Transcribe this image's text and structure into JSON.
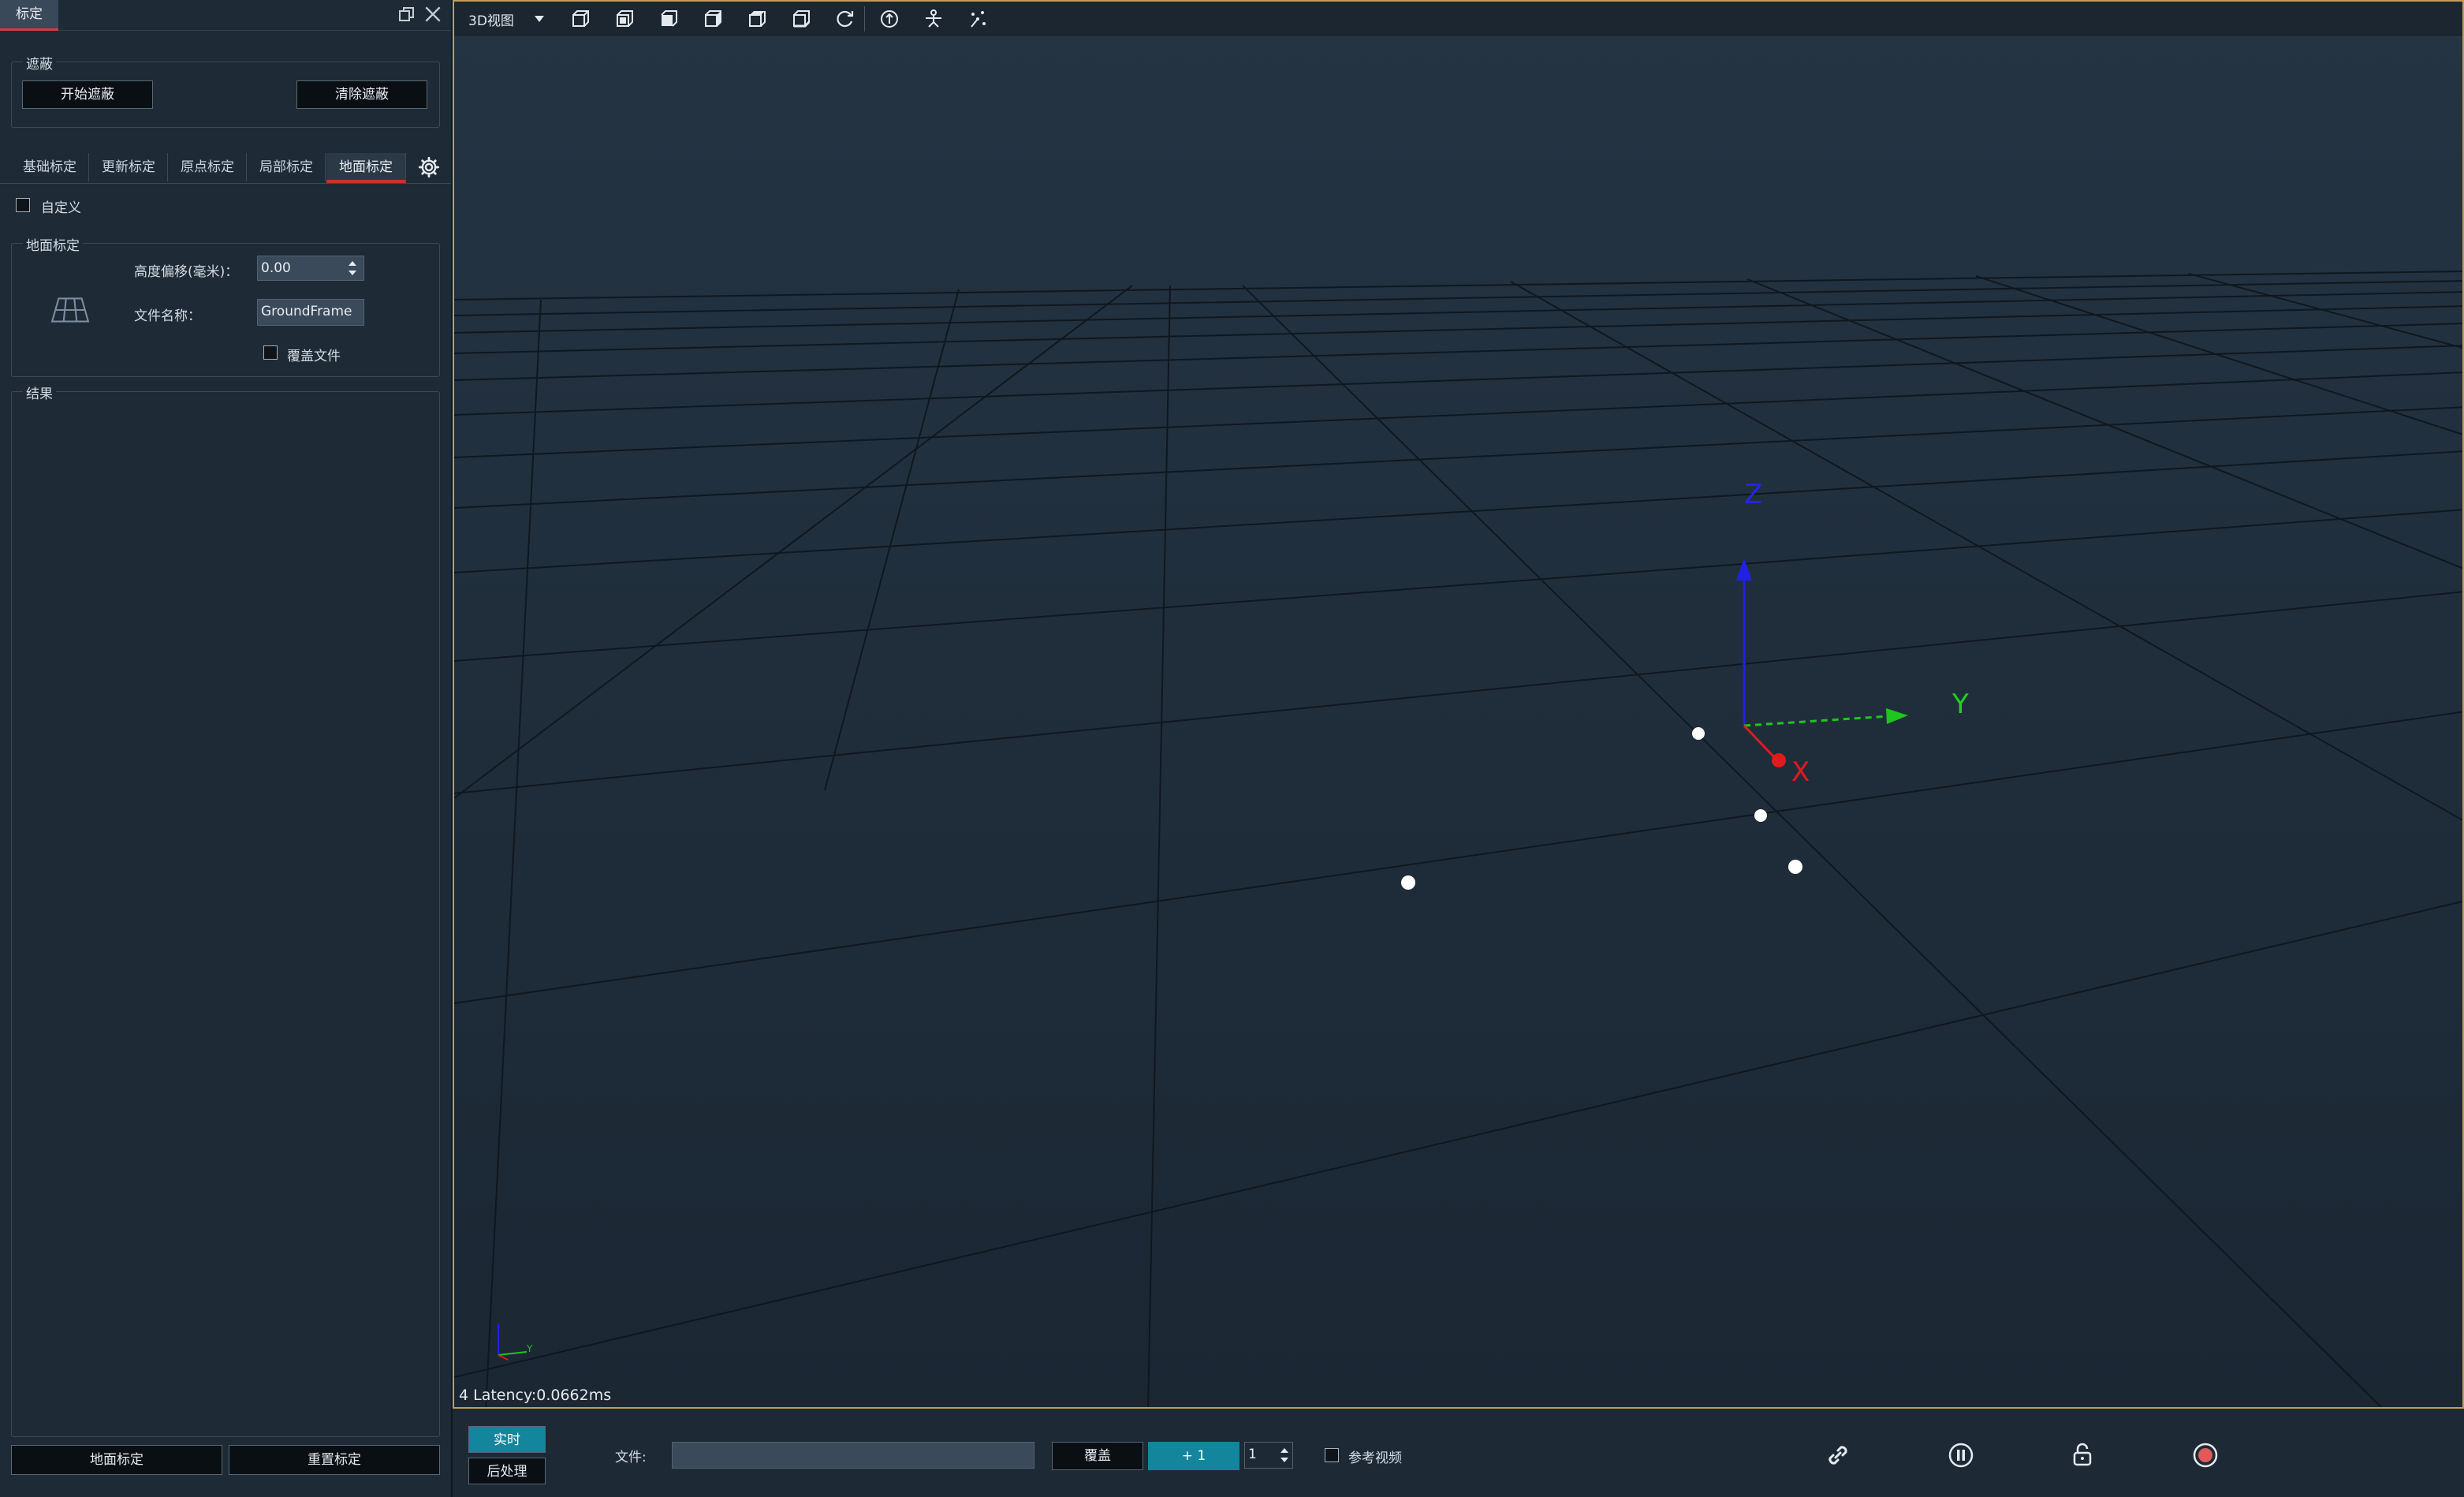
{
  "dock": {
    "title": "标定",
    "occlusion": {
      "legend": "遮蔽",
      "start_label": "开始遮蔽",
      "clear_label": "清除遮蔽"
    },
    "tabs": [
      {
        "label": "基础标定",
        "active": false
      },
      {
        "label": "更新标定",
        "active": false
      },
      {
        "label": "原点标定",
        "active": false
      },
      {
        "label": "局部标定",
        "active": false
      },
      {
        "label": "地面标定",
        "active": true
      }
    ],
    "custom_label": "自定义",
    "ground": {
      "legend": "地面标定",
      "height_offset_label": "高度偏移(毫米)：",
      "height_offset_value": "0.00",
      "file_name_label": "文件名称：",
      "file_name_value": "GroundFrame",
      "overwrite_label": "覆盖文件"
    },
    "results_legend": "结果",
    "ground_calib_button": "地面标定",
    "reset_calib_button": "重置标定"
  },
  "viewport": {
    "view_mode": "3D视图",
    "axis_labels": {
      "x": "X",
      "y": "Y",
      "z": "Z"
    },
    "mini_axis_y": "Y",
    "latency": "4 Latency:0.0662ms",
    "colors": {
      "x_axis": "#e01b1b",
      "y_axis": "#1ec61e",
      "z_axis": "#2020e6",
      "grid": "#0f171f",
      "background": "#243443",
      "markers": "#ffffff"
    },
    "markers_count": 5
  },
  "bottombar": {
    "realtime_label": "实时",
    "postprocess_label": "后处理",
    "file_label": "文件:",
    "file_value": "",
    "overwrite_label": "覆盖",
    "plus_one_label": "+ 1",
    "counter_value": "1",
    "reference_video_label": "参考视频",
    "accent": "#13859c",
    "record_color": "#e05a5a"
  }
}
